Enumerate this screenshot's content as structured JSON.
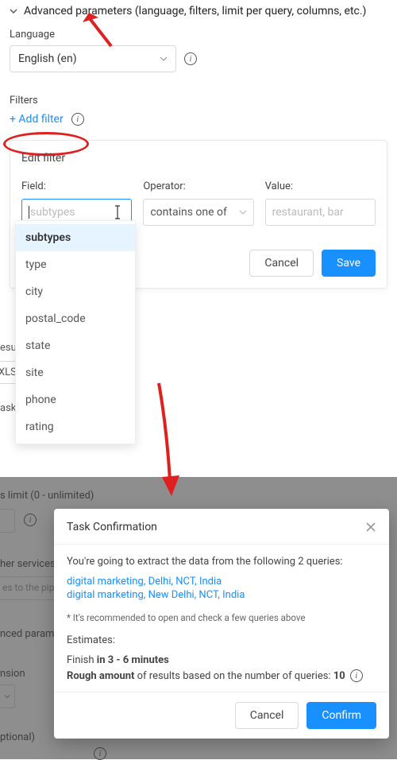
{
  "header": {
    "title": "Advanced parameters (language, filters, limit per query, columns, etc.)"
  },
  "language": {
    "label": "Language",
    "value": "English (en)"
  },
  "filters": {
    "label": "Filters",
    "add_label": "+ Add filter"
  },
  "edit_filter": {
    "title": "Edit filter",
    "field_label": "Field:",
    "field_placeholder": "subtypes",
    "operator_label": "Operator:",
    "operator_value": "contains one of",
    "value_label": "Value:",
    "value_placeholder": "restaurant, bar",
    "cancel": "Cancel",
    "save": "Save",
    "suggestions": [
      "subtypes",
      "type",
      "city",
      "postal_code",
      "state",
      "site",
      "phone",
      "rating"
    ]
  },
  "bg_fragments": {
    "esul": "esul",
    "xls": "XLS",
    "ask": "ask"
  },
  "lower_bg": {
    "limit": "s limit (0 - unlimited)",
    "services": "her services (",
    "pipe": "es to the pip",
    "params": "nced paramet",
    "nsion": "nsion",
    "optional": "ptional)"
  },
  "modal": {
    "title": "Task Confirmation",
    "intro": "You're going to extract the data from the following 2 queries:",
    "queries": [
      "digital marketing, Delhi, NCT, India",
      "digital marketing, New Delhi, NCT, India"
    ],
    "note": "* It's recommended to open and check a few queries above",
    "estimates_label": "Estimates:",
    "finish_prefix": "Finish ",
    "finish_bold": "in 3 - 6 minutes",
    "rough_bold": "Rough amount ",
    "rough_rest": "of results based on the number of queries: ",
    "rough_num": "10",
    "cancel": "Cancel",
    "confirm": "Confirm"
  }
}
